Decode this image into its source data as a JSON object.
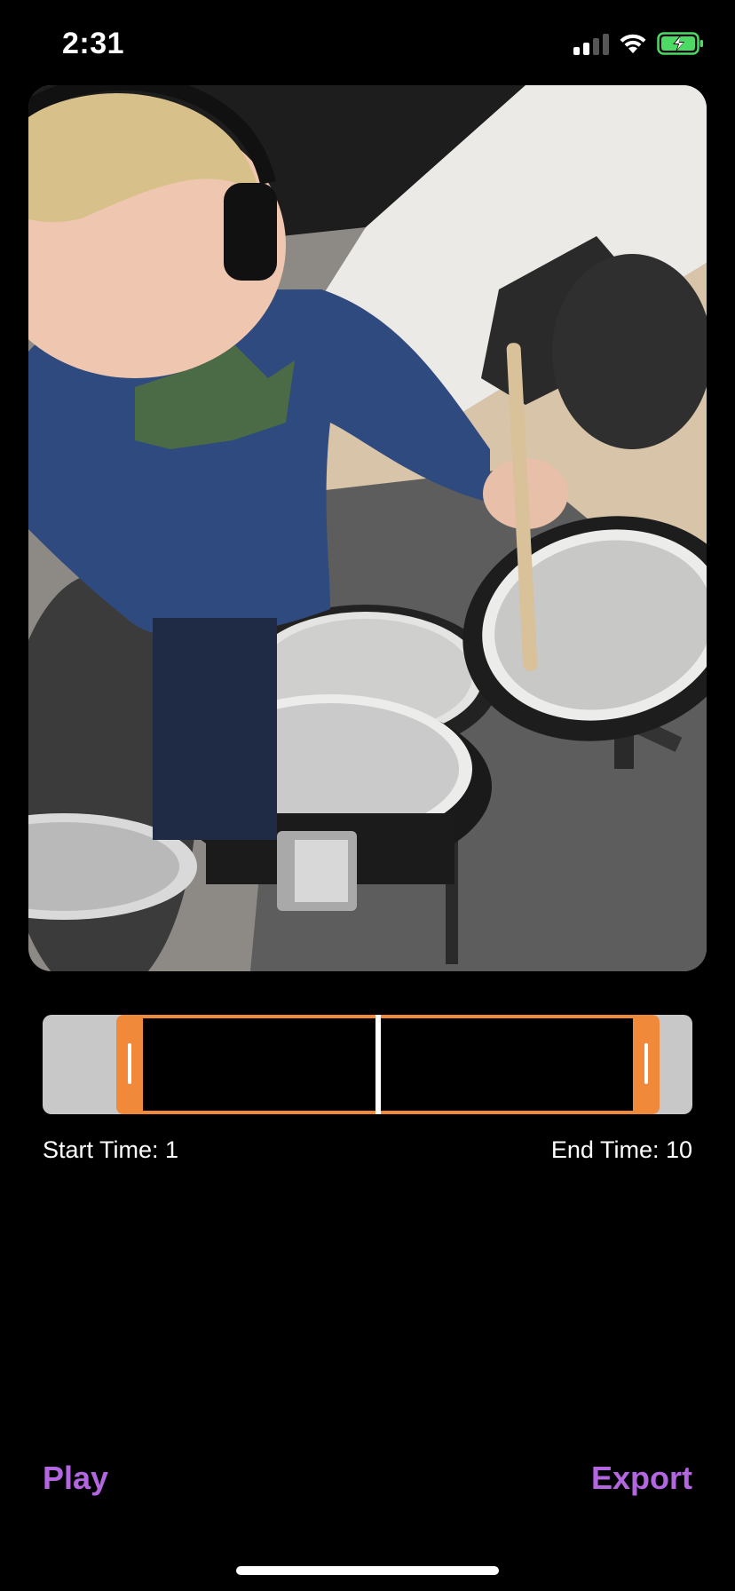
{
  "status_bar": {
    "time": "2:31",
    "icons": [
      "cellular-signal-icon",
      "wifi-icon",
      "battery-charging-icon"
    ],
    "battery_color": "#4cd964"
  },
  "video": {
    "description_icon": "video-preview"
  },
  "trimmer": {
    "accent_color": "#f0893a",
    "track_color": "#c8c8c8"
  },
  "times": {
    "start_label": "Start Time: 1",
    "end_label": "End Time: 10"
  },
  "actions": {
    "play_label": "Play",
    "export_label": "Export",
    "accent_color": "#b366e0"
  }
}
